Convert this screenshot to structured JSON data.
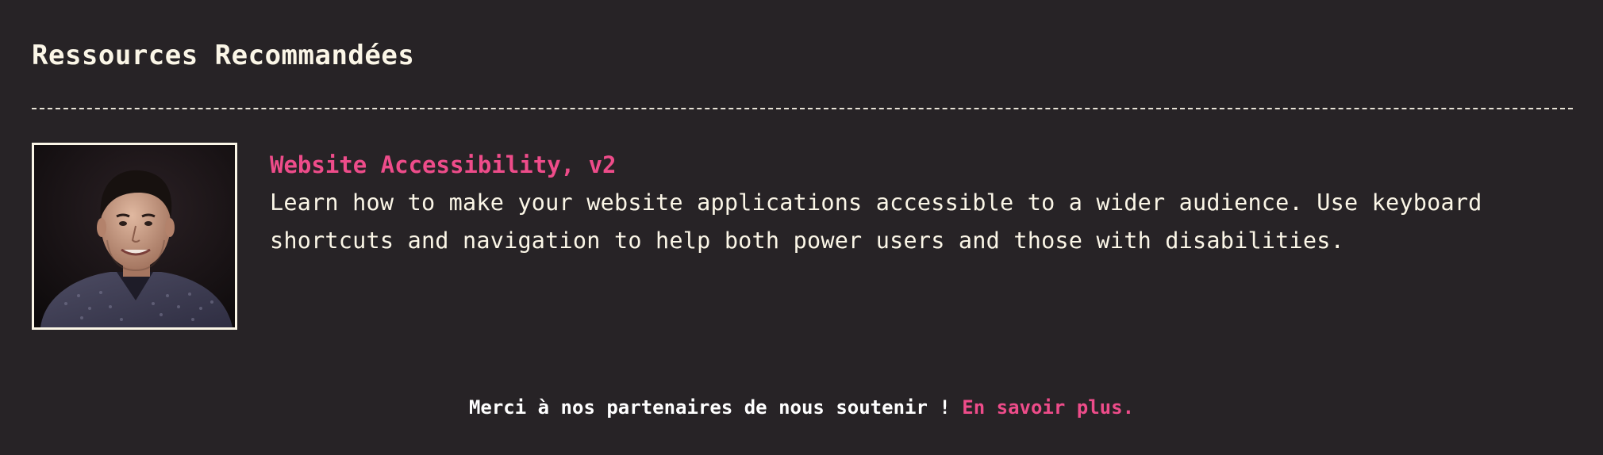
{
  "section": {
    "title": "Ressources Recommandées"
  },
  "resources": [
    {
      "title": "Website Accessibility, v2",
      "description": "Learn how to make your website applications accessible to a wider audience. Use keyboard shortcuts and navigation to help both power users and those with disabilities.",
      "thumbnail_icon": "instructor-portrait-photo"
    }
  ],
  "footer": {
    "thanks_text": "Merci à nos partenaires de nous soutenir !",
    "learn_more_label": "En savoir plus."
  },
  "colors": {
    "background": "#272326",
    "text": "#fbf6e7",
    "accent": "#ee4c8a"
  }
}
